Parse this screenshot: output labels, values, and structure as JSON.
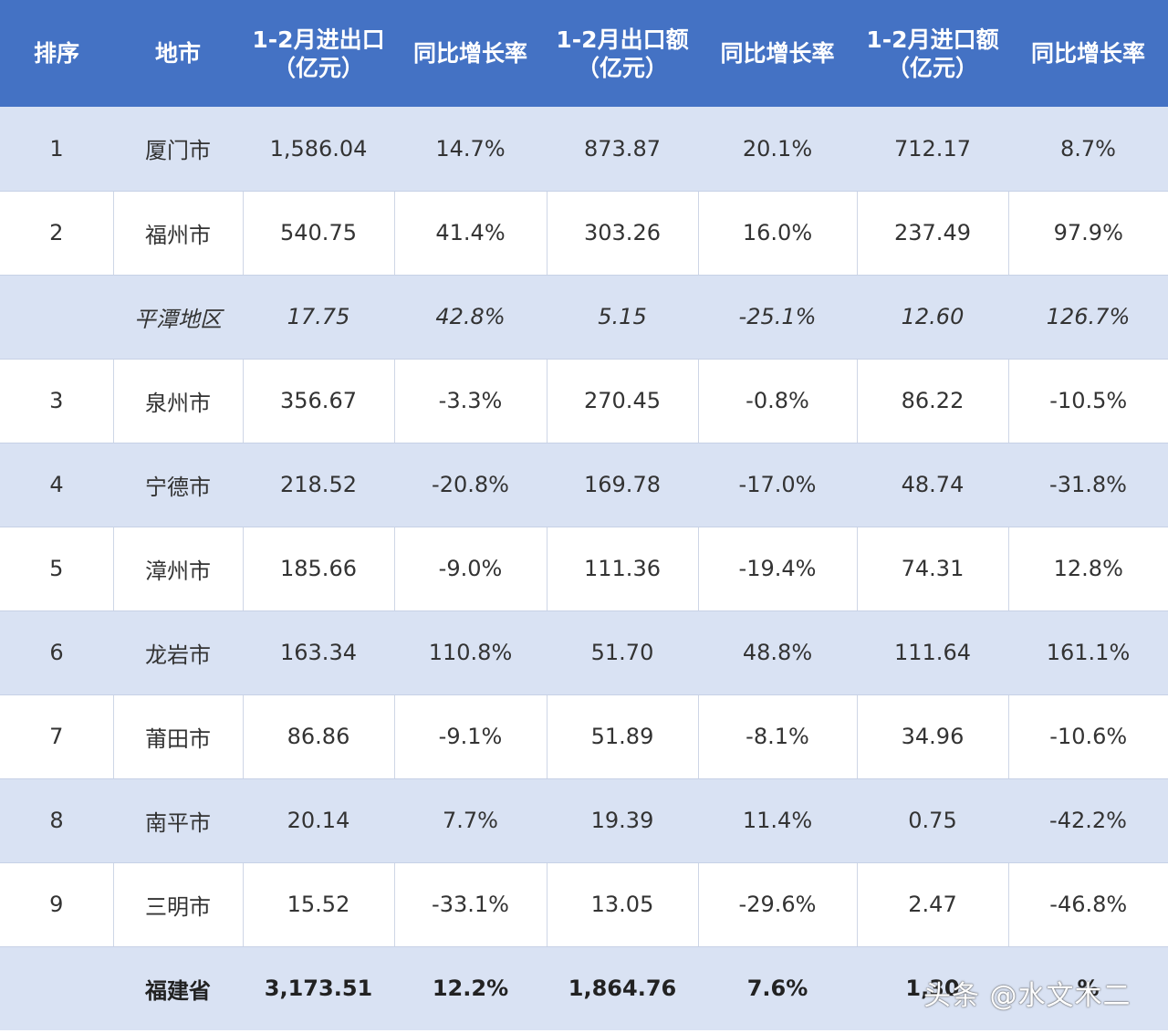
{
  "table": {
    "headers": [
      {
        "lines": [
          "排序"
        ]
      },
      {
        "lines": [
          "地市"
        ]
      },
      {
        "lines": [
          "1-2月进出口",
          "（亿元）"
        ]
      },
      {
        "lines": [
          "同比增长率"
        ]
      },
      {
        "lines": [
          "1-2月出口额",
          "（亿元）"
        ]
      },
      {
        "lines": [
          "同比增长率"
        ]
      },
      {
        "lines": [
          "1-2月进口额",
          "（亿元）"
        ]
      },
      {
        "lines": [
          "同比增长率"
        ]
      }
    ],
    "rows": [
      {
        "rank": "1",
        "city": "厦门市",
        "total": "1,586.04",
        "total_growth": "14.7%",
        "export": "873.87",
        "export_growth": "20.1%",
        "import": "712.17",
        "import_growth": "8.7%"
      },
      {
        "rank": "2",
        "city": "福州市",
        "total": "540.75",
        "total_growth": "41.4%",
        "export": "303.26",
        "export_growth": "16.0%",
        "import": "237.49",
        "import_growth": "97.9%"
      },
      {
        "rank": "",
        "city": "平潭地区",
        "total": "17.75",
        "total_growth": "42.8%",
        "export": "5.15",
        "export_growth": "-25.1%",
        "import": "12.60",
        "import_growth": "126.7%"
      },
      {
        "rank": "3",
        "city": "泉州市",
        "total": "356.67",
        "total_growth": "-3.3%",
        "export": "270.45",
        "export_growth": "-0.8%",
        "import": "86.22",
        "import_growth": "-10.5%"
      },
      {
        "rank": "4",
        "city": "宁德市",
        "total": "218.52",
        "total_growth": "-20.8%",
        "export": "169.78",
        "export_growth": "-17.0%",
        "import": "48.74",
        "import_growth": "-31.8%"
      },
      {
        "rank": "5",
        "city": "漳州市",
        "total": "185.66",
        "total_growth": "-9.0%",
        "export": "111.36",
        "export_growth": "-19.4%",
        "import": "74.31",
        "import_growth": "12.8%"
      },
      {
        "rank": "6",
        "city": "龙岩市",
        "total": "163.34",
        "total_growth": "110.8%",
        "export": "51.70",
        "export_growth": "48.8%",
        "import": "111.64",
        "import_growth": "161.1%"
      },
      {
        "rank": "7",
        "city": "莆田市",
        "total": "86.86",
        "total_growth": "-9.1%",
        "export": "51.89",
        "export_growth": "-8.1%",
        "import": "34.96",
        "import_growth": "-10.6%"
      },
      {
        "rank": "8",
        "city": "南平市",
        "total": "20.14",
        "total_growth": "7.7%",
        "export": "19.39",
        "export_growth": "11.4%",
        "import": "0.75",
        "import_growth": "-42.2%"
      },
      {
        "rank": "9",
        "city": "三明市",
        "total": "15.52",
        "total_growth": "-33.1%",
        "export": "13.05",
        "export_growth": "-29.6%",
        "import": "2.47",
        "import_growth": "-46.8%"
      }
    ],
    "total_row": {
      "rank": "",
      "city": "福建省",
      "total": "3,173.51",
      "total_growth": "12.2%",
      "export": "1,864.76",
      "export_growth": "7.6%",
      "import": "1,30",
      "import_growth": "%"
    }
  },
  "watermark": "头条 @水文木二",
  "colors": {
    "header_bg": "#4472c4",
    "band_bg": "#d9e2f3",
    "header_text": "#ffffff"
  }
}
